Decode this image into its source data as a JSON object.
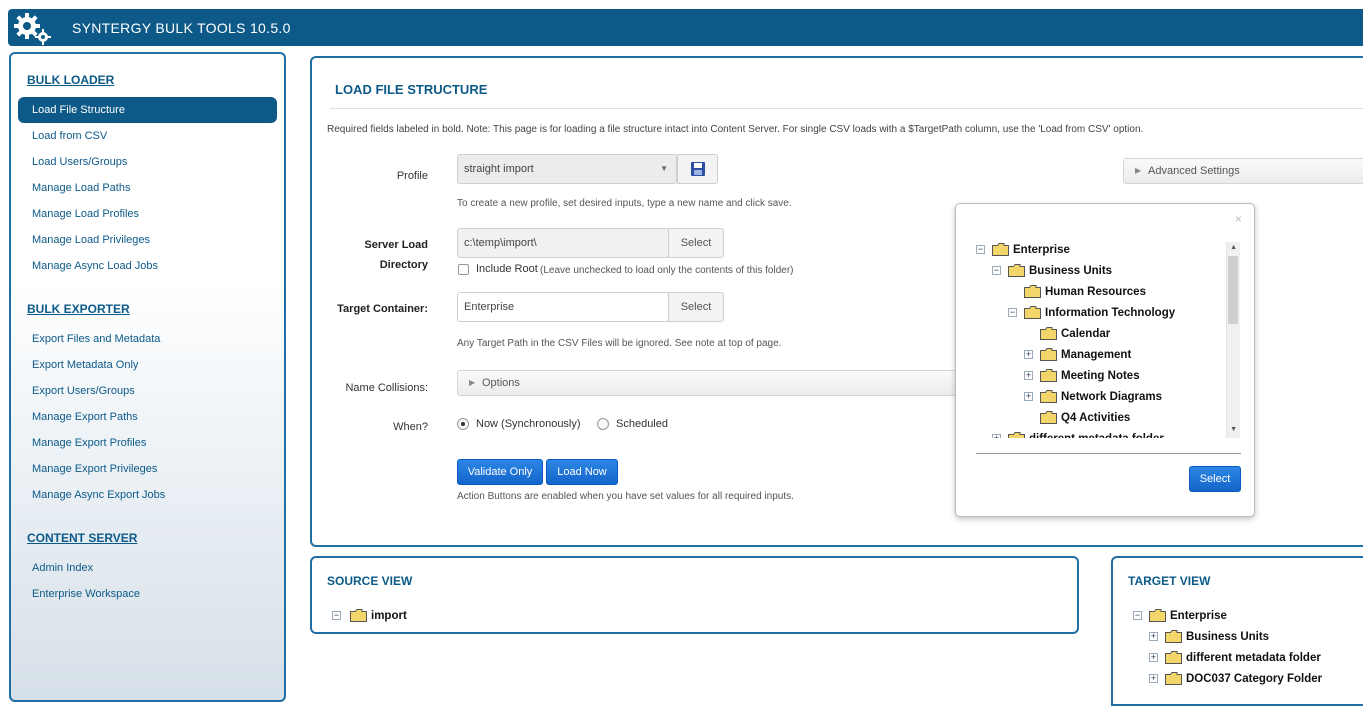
{
  "app": {
    "title": "SYNTERGY BULK TOOLS 10.5.0",
    "icon": "gears-icon"
  },
  "sidebar": {
    "sections": [
      {
        "heading": "BULK LOADER",
        "items": [
          "Load File Structure",
          "Load from CSV",
          "Load Users/Groups",
          "Manage Load Paths",
          "Manage Load Profiles",
          "Manage Load Privileges",
          "Manage Async Load Jobs"
        ]
      },
      {
        "heading": "BULK EXPORTER",
        "items": [
          "Export Files and Metadata",
          "Export Metadata Only",
          "Export Users/Groups",
          "Manage Export Paths",
          "Manage Export Profiles",
          "Manage Export Privileges",
          "Manage Async Export Jobs"
        ]
      },
      {
        "heading": "CONTENT SERVER",
        "items": [
          "Admin Index",
          "Enterprise Workspace"
        ]
      }
    ],
    "active_item": "Load File Structure"
  },
  "main": {
    "title": "LOAD FILE STRUCTURE",
    "note": "Required fields labeled in bold. Note: This page is for loading a file structure intact into Content Server. For single CSV loads with a $TargetPath column, use the 'Load from CSV' option.",
    "advanced_settings": "Advanced Settings",
    "profile": {
      "label": "Profile",
      "value": "straight import",
      "hint": "To create a new profile, set desired inputs, type a new name and click save."
    },
    "server_dir": {
      "label_line1": "Server Load",
      "label_line2": "Directory",
      "value": "c:\\temp\\import\\",
      "select": "Select",
      "include_root": "Include Root",
      "include_root_hint": "(Leave unchecked to load only the contents of this folder)"
    },
    "target": {
      "label": "Target Container:",
      "value": "Enterprise",
      "select": "Select",
      "hint": "Any Target Path in the CSV Files will be ignored. See note at top of page."
    },
    "collisions": {
      "label": "Name Collisions:",
      "options": "Options"
    },
    "when": {
      "label": "When?",
      "now": "Now (Synchronously)",
      "scheduled": "Scheduled",
      "selected": "now"
    },
    "buttons": {
      "validate": "Validate Only",
      "load": "Load Now",
      "hint": "Action Buttons are enabled when you have set values for all required inputs."
    }
  },
  "popup": {
    "close": "×",
    "select": "Select",
    "tree": [
      {
        "label": "Enterprise",
        "level": 0,
        "toggle": "−"
      },
      {
        "label": "Business Units",
        "level": 1,
        "toggle": "−"
      },
      {
        "label": "Human Resources",
        "level": 2,
        "toggle": ""
      },
      {
        "label": "Information Technology",
        "level": 2,
        "toggle": "−"
      },
      {
        "label": "Calendar",
        "level": 3,
        "toggle": ""
      },
      {
        "label": "Management",
        "level": 3,
        "toggle": "+"
      },
      {
        "label": "Meeting Notes",
        "level": 3,
        "toggle": "+"
      },
      {
        "label": "Network Diagrams",
        "level": 3,
        "toggle": "+"
      },
      {
        "label": "Q4 Activities",
        "level": 3,
        "toggle": ""
      },
      {
        "label": "different metadata folder",
        "level": 1,
        "toggle": "+"
      }
    ]
  },
  "source_view": {
    "title": "SOURCE VIEW",
    "root": "import"
  },
  "target_view": {
    "title": "TARGET VIEW",
    "tree": [
      {
        "label": "Enterprise",
        "level": 0,
        "toggle": "−"
      },
      {
        "label": "Business Units",
        "level": 1,
        "toggle": "+"
      },
      {
        "label": "different metadata folder",
        "level": 1,
        "toggle": "+"
      },
      {
        "label": "DOC037 Category Folder",
        "level": 1,
        "toggle": "+"
      }
    ]
  },
  "colors": {
    "brand": "#0d5a89",
    "action": "#1565c9",
    "folder": "#f3d66a"
  }
}
